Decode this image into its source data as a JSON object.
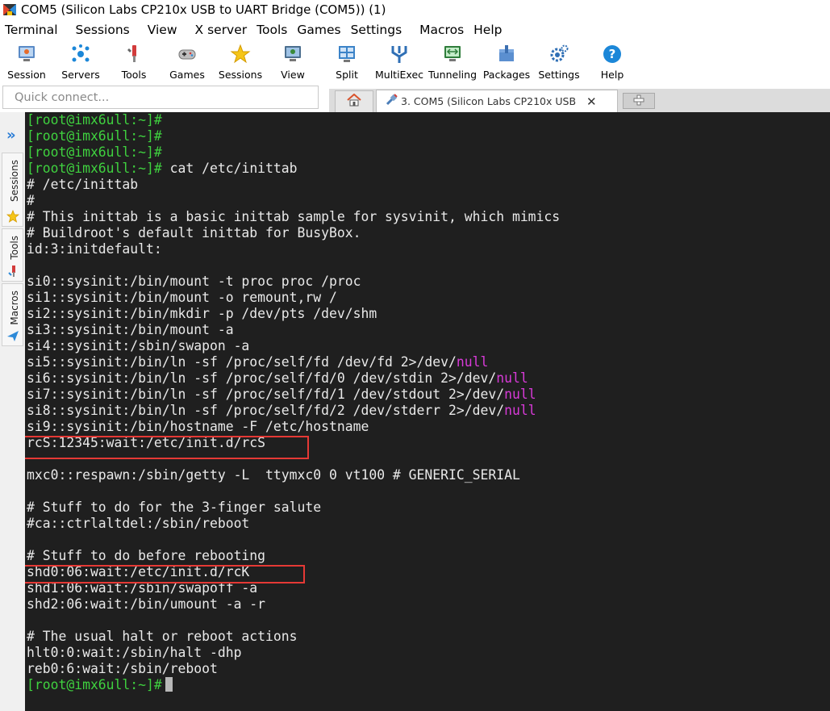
{
  "window": {
    "title": "COM5  (Silicon Labs CP210x USB to UART Bridge (COM5)) (1)"
  },
  "menu": {
    "items": [
      "Terminal",
      "Sessions",
      "View",
      "X server",
      "Tools",
      "Games",
      "Settings",
      "Macros",
      "Help"
    ]
  },
  "toolbar": {
    "buttons": [
      {
        "label": "Session",
        "icon": "session-icon"
      },
      {
        "label": "Servers",
        "icon": "servers-icon"
      },
      {
        "label": "Tools",
        "icon": "tools-icon"
      },
      {
        "label": "Games",
        "icon": "games-icon"
      },
      {
        "label": "Sessions",
        "icon": "star-icon"
      },
      {
        "label": "View",
        "icon": "view-icon"
      },
      {
        "label": "Split",
        "icon": "split-icon"
      },
      {
        "label": "MultiExec",
        "icon": "multiexec-icon"
      },
      {
        "label": "Tunneling",
        "icon": "tunneling-icon"
      },
      {
        "label": "Packages",
        "icon": "packages-icon"
      },
      {
        "label": "Settings",
        "icon": "gear-icon"
      },
      {
        "label": "Help",
        "icon": "help-icon"
      }
    ]
  },
  "quick_connect": {
    "placeholder": "Quick connect..."
  },
  "tabs": {
    "home_icon": "home-icon",
    "session_tab_label": "3. COM5  (Silicon Labs CP210x USB",
    "close_glyph": "✕"
  },
  "side_panel": {
    "labels": [
      "Sessions",
      "Tools",
      "Macros"
    ]
  },
  "terminal": {
    "colors": {
      "background": "#1f1f1f",
      "text": "#e9e9e9",
      "prompt": "#3fd13f",
      "highlight": "#d93ad9",
      "annotation": "#e53935"
    },
    "lines": [
      {
        "parts": [
          {
            "t": "[root@imx6ull:~]#",
            "c": "prompt"
          }
        ]
      },
      {
        "parts": [
          {
            "t": "[root@imx6ull:~]#",
            "c": "prompt"
          }
        ]
      },
      {
        "parts": [
          {
            "t": "[root@imx6ull:~]#",
            "c": "prompt"
          }
        ]
      },
      {
        "parts": [
          {
            "t": "[root@imx6ull:~]#",
            "c": "prompt"
          },
          {
            "t": " cat /etc/inittab",
            "c": ""
          }
        ]
      },
      {
        "parts": [
          {
            "t": "# /etc/inittab",
            "c": ""
          }
        ]
      },
      {
        "parts": [
          {
            "t": "#",
            "c": ""
          }
        ]
      },
      {
        "parts": [
          {
            "t": "# This inittab is a basic inittab sample for sysvinit, which mimics",
            "c": ""
          }
        ]
      },
      {
        "parts": [
          {
            "t": "# Buildroot's default inittab for BusyBox.",
            "c": ""
          }
        ]
      },
      {
        "parts": [
          {
            "t": "id:3:initdefault:",
            "c": ""
          }
        ]
      },
      {
        "parts": [
          {
            "t": "",
            "c": ""
          }
        ]
      },
      {
        "parts": [
          {
            "t": "si0::sysinit:/bin/mount -t proc proc /proc",
            "c": ""
          }
        ]
      },
      {
        "parts": [
          {
            "t": "si1::sysinit:/bin/mount -o remount,rw /",
            "c": ""
          }
        ]
      },
      {
        "parts": [
          {
            "t": "si2::sysinit:/bin/mkdir -p /dev/pts /dev/shm",
            "c": ""
          }
        ]
      },
      {
        "parts": [
          {
            "t": "si3::sysinit:/bin/mount -a",
            "c": ""
          }
        ]
      },
      {
        "parts": [
          {
            "t": "si4::sysinit:/sbin/swapon -a",
            "c": ""
          }
        ]
      },
      {
        "parts": [
          {
            "t": "si5::sysinit:/bin/ln -sf /proc/self/fd /dev/fd 2>/dev/",
            "c": ""
          },
          {
            "t": "null",
            "c": "magenta"
          }
        ]
      },
      {
        "parts": [
          {
            "t": "si6::sysinit:/bin/ln -sf /proc/self/fd/0 /dev/stdin 2>/dev/",
            "c": ""
          },
          {
            "t": "null",
            "c": "magenta"
          }
        ]
      },
      {
        "parts": [
          {
            "t": "si7::sysinit:/bin/ln -sf /proc/self/fd/1 /dev/stdout 2>/dev/",
            "c": ""
          },
          {
            "t": "null",
            "c": "magenta"
          }
        ]
      },
      {
        "parts": [
          {
            "t": "si8::sysinit:/bin/ln -sf /proc/self/fd/2 /dev/stderr 2>/dev/",
            "c": ""
          },
          {
            "t": "null",
            "c": "magenta"
          }
        ]
      },
      {
        "parts": [
          {
            "t": "si9::sysinit:/bin/hostname -F /etc/hostname",
            "c": ""
          }
        ]
      },
      {
        "parts": [
          {
            "t": "rcS:12345:wait:/etc/init.d/rcS",
            "c": ""
          }
        ],
        "boxed": true
      },
      {
        "parts": [
          {
            "t": "",
            "c": ""
          }
        ]
      },
      {
        "parts": [
          {
            "t": "mxc0::respawn:/sbin/getty -L  ttymxc0 0 vt100 # GENERIC_SERIAL",
            "c": ""
          }
        ]
      },
      {
        "parts": [
          {
            "t": "",
            "c": ""
          }
        ]
      },
      {
        "parts": [
          {
            "t": "# Stuff to do for the 3-finger salute",
            "c": ""
          }
        ]
      },
      {
        "parts": [
          {
            "t": "#ca::ctrlaltdel:/sbin/reboot",
            "c": ""
          }
        ]
      },
      {
        "parts": [
          {
            "t": "",
            "c": ""
          }
        ]
      },
      {
        "parts": [
          {
            "t": "# Stuff to do before rebooting",
            "c": ""
          }
        ]
      },
      {
        "parts": [
          {
            "t": "shd0:06:wait:/etc/init.d/rcK",
            "c": ""
          }
        ],
        "boxed": true
      },
      {
        "parts": [
          {
            "t": "shd1:06:wait:/sbin/swapoff -a",
            "c": ""
          }
        ]
      },
      {
        "parts": [
          {
            "t": "shd2:06:wait:/bin/umount -a -r",
            "c": ""
          }
        ]
      },
      {
        "parts": [
          {
            "t": "",
            "c": ""
          }
        ]
      },
      {
        "parts": [
          {
            "t": "# The usual halt or reboot actions",
            "c": ""
          }
        ]
      },
      {
        "parts": [
          {
            "t": "hlt0:0:wait:/sbin/halt -dhp",
            "c": ""
          }
        ]
      },
      {
        "parts": [
          {
            "t": "reb0:6:wait:/sbin/reboot",
            "c": ""
          }
        ]
      },
      {
        "parts": [
          {
            "t": "[root@imx6ull:~]#",
            "c": "prompt"
          }
        ],
        "cursor": true
      }
    ]
  }
}
